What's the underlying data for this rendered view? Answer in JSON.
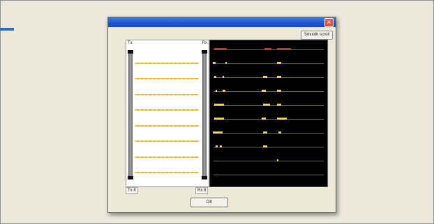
{
  "dialog": {
    "close_glyph": "×",
    "smooth_scroll_label": "Smooth scroll",
    "tx_corner_label": "Tx",
    "rx_corner_label": "Rx",
    "tx_bottom_label": "Tx 8",
    "rx_bottom_label": "Rx 8",
    "ok_label": "OK"
  },
  "colors": {
    "beam": "#f0cd4a",
    "pulse": "#f4d83a",
    "sync_pulse": "#e02828",
    "rx_background": "#000000",
    "titlebar": "#1d55cf"
  },
  "beam_count": 8
}
